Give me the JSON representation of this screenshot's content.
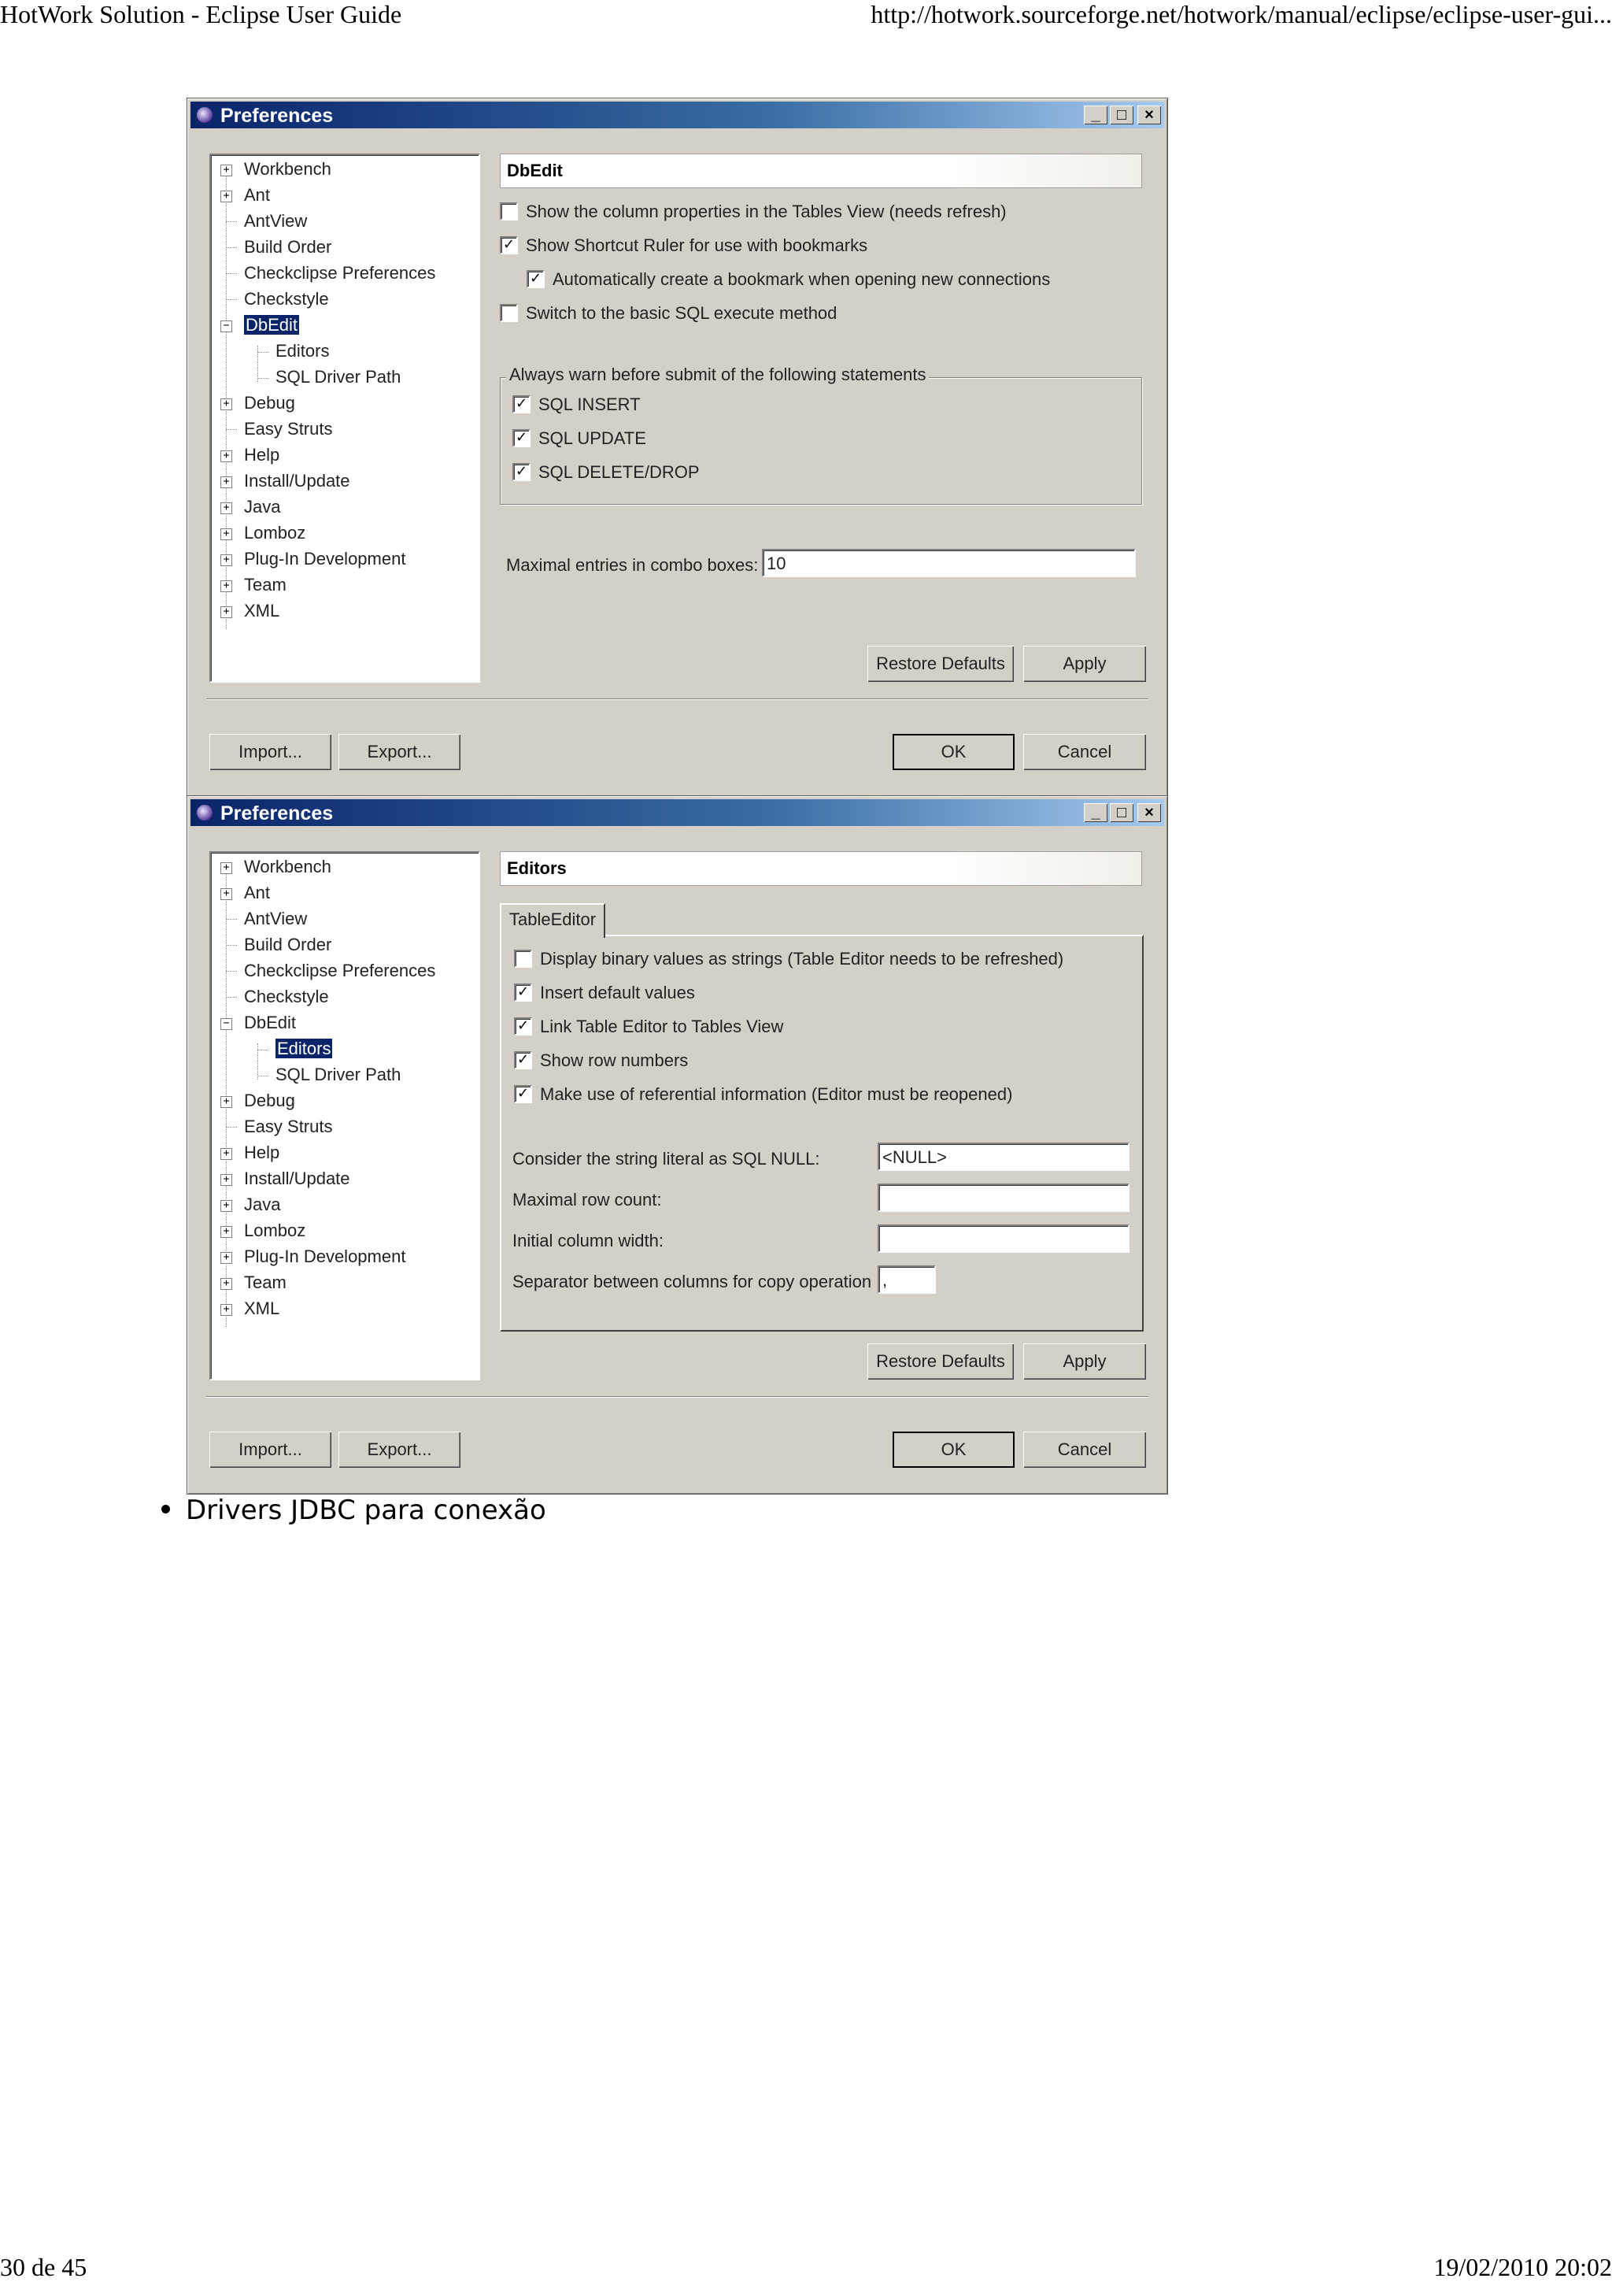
{
  "page_header": {
    "title": "HotWork Solution - Eclipse User Guide",
    "url": "http://hotwork.sourceforge.net/hotwork/manual/eclipse/eclipse-user-gui..."
  },
  "page_footer": {
    "page": "30 de 45",
    "datetime": "19/02/2010 20:02"
  },
  "dialog_common": {
    "title": "Preferences",
    "min_glyph": "_",
    "max_glyph": "□",
    "close_glyph": "×",
    "tree": {
      "workbench": "Workbench",
      "ant": "Ant",
      "antview": "AntView",
      "build_order": "Build Order",
      "checkclipse": "Checkclipse Preferences",
      "checkstyle": "Checkstyle",
      "dbedit": "DbEdit",
      "editors": "Editors",
      "sql_driver_path": "SQL Driver Path",
      "debug": "Debug",
      "easy_struts": "Easy Struts",
      "help": "Help",
      "install_update": "Install/Update",
      "java": "Java",
      "lomboz": "Lomboz",
      "plugin_dev": "Plug-In Development",
      "team": "Team",
      "xml": "XML"
    },
    "expand_plus": "+",
    "expand_minus": "−",
    "restore_defaults": "Restore Defaults",
    "apply": "Apply",
    "import": "Import...",
    "export": "Export...",
    "ok": "OK",
    "cancel": "Cancel",
    "check_mark": "✓"
  },
  "dialog1": {
    "page_title": "DbEdit",
    "options": {
      "show_column_props": "Show the column properties in the Tables View (needs refresh)",
      "show_shortcut_ruler": "Show Shortcut Ruler for use with bookmarks",
      "auto_bookmark": "Automatically create a bookmark when opening new connections",
      "basic_sql": "Switch to the basic SQL execute method"
    },
    "warn_group": {
      "legend": "Always warn before submit of the following statements",
      "sql_insert": "SQL INSERT",
      "sql_update": "SQL UPDATE",
      "sql_delete": "SQL DELETE/DROP"
    },
    "max_entries_label": "Maximal entries in combo boxes:",
    "max_entries_value": "10"
  },
  "dialog2": {
    "page_title": "Editors",
    "tab_label": "TableEditor",
    "options": {
      "display_binary": "Display binary values as strings (Table Editor needs to be refreshed)",
      "insert_default": "Insert default values",
      "link_table_editor": "Link Table Editor to Tables View",
      "show_row_numbers": "Show row numbers",
      "referential_info": "Make use of referential information (Editor must be reopened)"
    },
    "fields": {
      "null_label": "Consider the string literal as SQL NULL:",
      "null_value": "<NULL>",
      "max_row_label": "Maximal row count:",
      "max_row_value": "",
      "col_width_label": "Initial column width:",
      "col_width_value": "",
      "separator_label": "Separator between columns for copy operation",
      "separator_value": ","
    }
  },
  "bullet": {
    "text": "Drivers JDBC para conexão"
  }
}
